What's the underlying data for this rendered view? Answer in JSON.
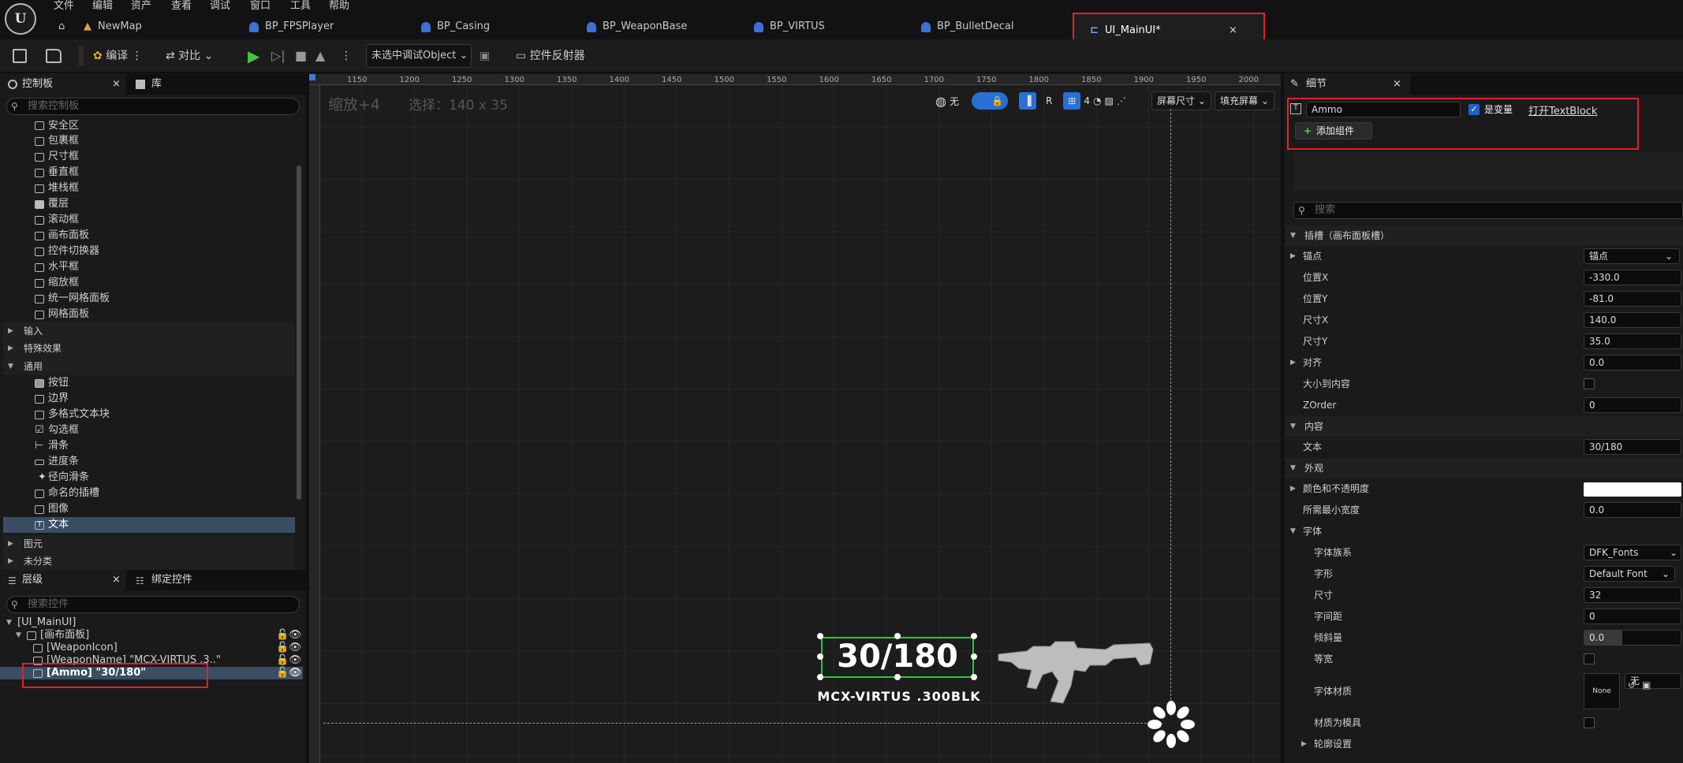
{
  "menubar": {
    "items": [
      "文件",
      "编辑",
      "资产",
      "查看",
      "调试",
      "窗口",
      "工具",
      "帮助"
    ]
  },
  "tabs": [
    {
      "label": "NewMap",
      "icon": "level-icon"
    },
    {
      "label": "BP_FPSPlayer",
      "icon": "blueprint-icon"
    },
    {
      "label": "BP_Casing",
      "icon": "blueprint-icon"
    },
    {
      "label": "BP_WeaponBase",
      "icon": "blueprint-icon"
    },
    {
      "label": "BP_VIRTUS",
      "icon": "blueprint-icon"
    },
    {
      "label": "BP_BulletDecal",
      "icon": "blueprint-icon"
    },
    {
      "label": "UI_MainUI*",
      "icon": "widget-blueprint-icon",
      "active": true
    }
  ],
  "toolbar": {
    "compile": "编译",
    "diff": "对比",
    "debug_object": "未选中调试Object",
    "reflector": "控件反射器"
  },
  "palette": {
    "tab_label": "控制板",
    "library_label": "库",
    "search_placeholder": "搜索控制板",
    "panel_items": [
      "安全区",
      "包裹框",
      "尺寸框",
      "垂直框",
      "堆栈框",
      "覆层",
      "滚动框",
      "画布面板",
      "控件切换器",
      "水平框",
      "缩放框",
      "统一网格面板",
      "网格面板"
    ],
    "categories": {
      "input": "输入",
      "effects": "特殊效果",
      "common": "通用",
      "primitive": "图元",
      "uncategorized": "未分类"
    },
    "common_items": [
      "按钮",
      "边界",
      "多格式文本块",
      "勾选框",
      "滑条",
      "进度条",
      "径向滑条",
      "命名的插槽",
      "图像",
      "文本"
    ]
  },
  "hierarchy": {
    "tab_label": "层级",
    "bind_label": "绑定控件",
    "search_placeholder": "搜索控件",
    "items": [
      "[UI_MainUI]",
      "[画布面板]",
      "[WeaponIcon]",
      "[WeaponName] \"MCX-VIRTUS .3..\"",
      "[Ammo] \"30/180\""
    ]
  },
  "canvas": {
    "zoom": "缩放+4",
    "selection": "选择：140 x 35",
    "ruler_labels": [
      "1150",
      "1200",
      "1250",
      "1300",
      "1350",
      "1400",
      "1450",
      "1500",
      "1550",
      "1600",
      "1650",
      "1700",
      "1750",
      "1800",
      "1850",
      "1900",
      "1950",
      "2000"
    ],
    "toolbar": {
      "none": "无",
      "r": "R",
      "grid": "4",
      "screen_size": "屏幕尺寸",
      "fill_screen": "填充屏幕"
    },
    "ammo_text": "30/180",
    "weapon_name": "MCX-VIRTUS .300BLK"
  },
  "details": {
    "tab_label": "细节",
    "name_value": "Ammo",
    "is_variable": "是变量",
    "open_link": "打开TextBlock",
    "add_component": "添加组件",
    "search_placeholder": "搜索",
    "slot_section": "插槽（画布面板槽）",
    "anchor_label": "锚点",
    "anchor_value": "锚点",
    "pos_x_label": "位置X",
    "pos_x": "-330.0",
    "pos_y_label": "位置Y",
    "pos_y": "-81.0",
    "size_x_label": "尺寸X",
    "size_x": "140.0",
    "size_y_label": "尺寸Y",
    "size_y": "35.0",
    "align_label": "对齐",
    "align_value": "0.0",
    "autosize_label": "大小到内容",
    "zorder_label": "ZOrder",
    "zorder": "0",
    "content_section": "内容",
    "text_label": "文本",
    "text_value": "30/180",
    "appearance_section": "外观",
    "color_label": "颜色和不透明度",
    "min_width_label": "所需最小宽度",
    "min_width": "0.0",
    "font_section": "字体",
    "font_family_label": "字体族系",
    "font_family": "DFK_Fonts",
    "typeface_label": "字形",
    "typeface": "Default Font",
    "size_label": "尺寸",
    "size": "32",
    "spacing_label": "字间距",
    "spacing": "0",
    "skew_label": "倾斜量",
    "skew": "0.0",
    "mono_label": "等宽",
    "material_label": "字体材质",
    "material_thumb": "None",
    "material_value": "无",
    "mask_label": "材质为模具",
    "outline_label": "轮廓设置"
  }
}
